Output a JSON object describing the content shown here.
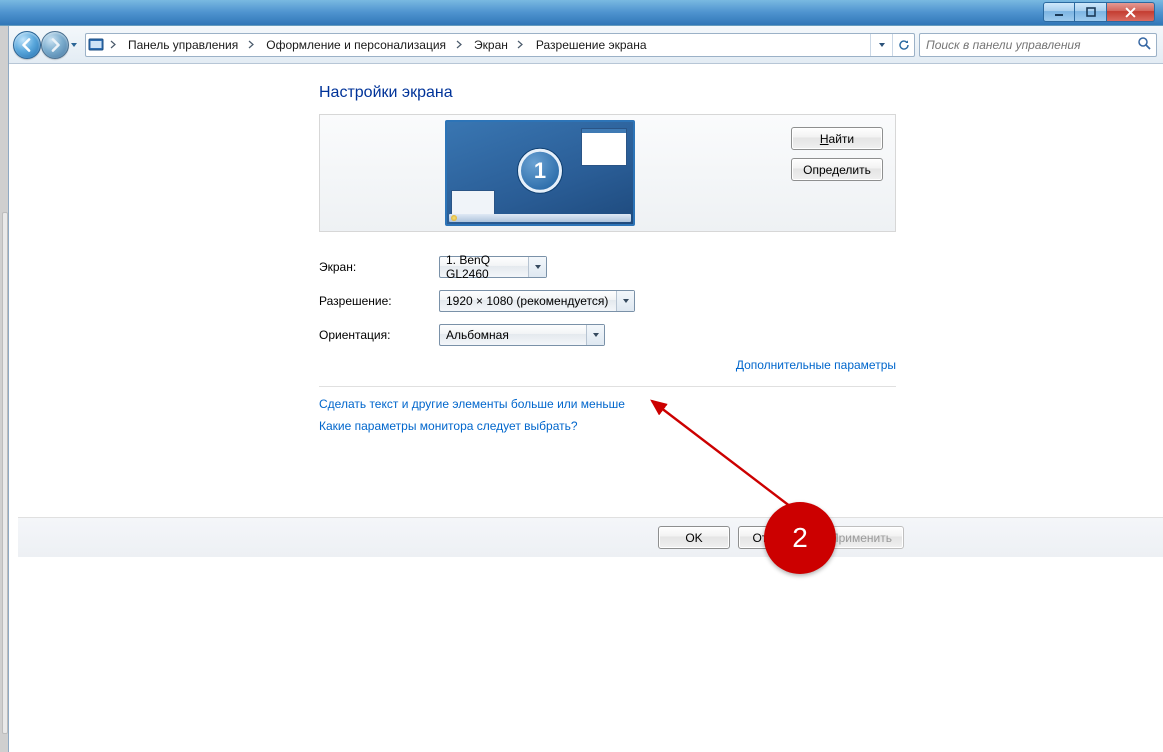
{
  "window_controls": {
    "minimize": "minimize",
    "maximize": "maximize",
    "close": "close"
  },
  "breadcrumb": {
    "root": "Панель управления",
    "a": "Оформление и персонализация",
    "b": "Экран",
    "c": "Разрешение экрана"
  },
  "search": {
    "placeholder": "Поиск в панели управления"
  },
  "page": {
    "title": "Настройки экрана"
  },
  "monitor": {
    "number": "1"
  },
  "buttons": {
    "find_prefix": "Н",
    "find_rest": "айти",
    "detect": "Определить",
    "ok": "OK",
    "cancel": "Отмена",
    "apply": "Применить"
  },
  "form": {
    "screen_label": "Экран:",
    "screen_value": "1. BenQ GL2460",
    "resolution_label": "Разрешение:",
    "resolution_value": "1920 × 1080 (рекомендуется)",
    "orientation_label": "Ориентация:",
    "orientation_value": "Альбомная"
  },
  "links": {
    "advanced": "Дополнительные параметры",
    "textsize": "Сделать текст и другие элементы больше или меньше",
    "which": "Какие параметры монитора следует выбрать?"
  },
  "annotation": {
    "label": "2"
  }
}
